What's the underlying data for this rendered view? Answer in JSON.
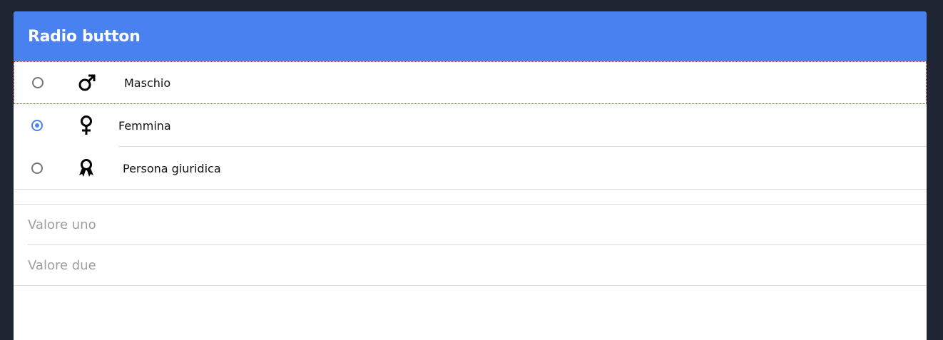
{
  "header": {
    "title": "Radio button"
  },
  "radio_group": {
    "items": [
      {
        "label": "Maschio",
        "icon": "male-symbol-icon",
        "checked": false,
        "focused": true
      },
      {
        "label": "Femmina",
        "icon": "female-symbol-icon",
        "checked": true,
        "focused": false
      },
      {
        "label": "Persona giuridica",
        "icon": "award-ribbon-icon",
        "checked": false,
        "focused": false
      }
    ]
  },
  "values": {
    "items": [
      {
        "label": "Valore uno"
      },
      {
        "label": "Valore due"
      }
    ]
  },
  "colors": {
    "background": "#1f2533",
    "accent": "#4a81f0",
    "focus_outline": "#b8252a"
  }
}
